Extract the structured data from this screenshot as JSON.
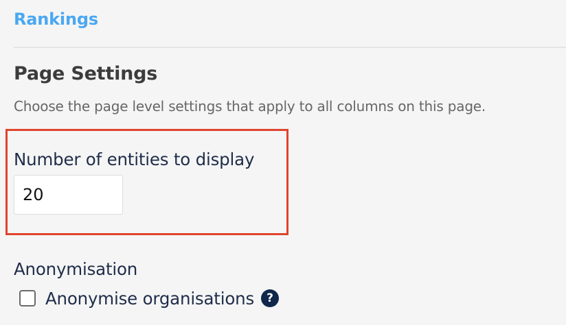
{
  "nav": {
    "tab_label": "Rankings"
  },
  "section": {
    "title": "Page Settings",
    "description": "Choose the page level settings that apply to all columns on this page."
  },
  "entities_field": {
    "label": "Number of entities to display",
    "value": "20"
  },
  "anonymisation": {
    "group_label": "Anonymisation",
    "checkbox_label": "Anonymise organisations",
    "checked": false,
    "help_icon_glyph": "?"
  },
  "colors": {
    "tab_link": "#4aa8f2",
    "highlight_border": "#e0442c",
    "help_icon_bg": "#10264a",
    "label_text": "#1f2d4a"
  }
}
